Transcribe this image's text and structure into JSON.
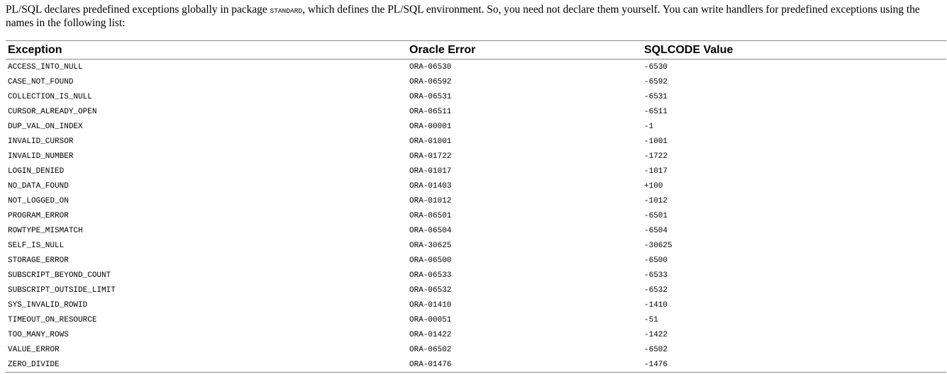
{
  "intro": {
    "text_before": "PL/SQL declares predefined exceptions globally in package ",
    "package_name": "STANDARD",
    "text_after": ", which defines the PL/SQL environment. So, you need not declare them yourself. You can write handlers for predefined exceptions using the names in the following list:"
  },
  "table": {
    "headers": {
      "exception": "Exception",
      "oracle_error": "Oracle Error",
      "sqlcode": "SQLCODE Value"
    },
    "rows": [
      {
        "exception": "ACCESS_INTO_NULL",
        "oracle_error": "ORA-06530",
        "sqlcode": "-6530"
      },
      {
        "exception": "CASE_NOT_FOUND",
        "oracle_error": "ORA-06592",
        "sqlcode": "-6592"
      },
      {
        "exception": "COLLECTION_IS_NULL",
        "oracle_error": "ORA-06531",
        "sqlcode": "-6531"
      },
      {
        "exception": "CURSOR_ALREADY_OPEN",
        "oracle_error": "ORA-06511",
        "sqlcode": "-6511"
      },
      {
        "exception": "DUP_VAL_ON_INDEX",
        "oracle_error": "ORA-00001",
        "sqlcode": "-1"
      },
      {
        "exception": "INVALID_CURSOR",
        "oracle_error": "ORA-01001",
        "sqlcode": "-1001"
      },
      {
        "exception": "INVALID_NUMBER",
        "oracle_error": "ORA-01722",
        "sqlcode": "-1722"
      },
      {
        "exception": "LOGIN_DENIED",
        "oracle_error": "ORA-01017",
        "sqlcode": "-1017"
      },
      {
        "exception": "NO_DATA_FOUND",
        "oracle_error": "ORA-01403",
        "sqlcode": "+100"
      },
      {
        "exception": "NOT_LOGGED_ON",
        "oracle_error": "ORA-01012",
        "sqlcode": "-1012"
      },
      {
        "exception": "PROGRAM_ERROR",
        "oracle_error": "ORA-06501",
        "sqlcode": "-6501"
      },
      {
        "exception": "ROWTYPE_MISMATCH",
        "oracle_error": "ORA-06504",
        "sqlcode": "-6504"
      },
      {
        "exception": "SELF_IS_NULL",
        "oracle_error": "ORA-30625",
        "sqlcode": "-30625"
      },
      {
        "exception": "STORAGE_ERROR",
        "oracle_error": "ORA-06500",
        "sqlcode": "-6500"
      },
      {
        "exception": "SUBSCRIPT_BEYOND_COUNT",
        "oracle_error": "ORA-06533",
        "sqlcode": "-6533"
      },
      {
        "exception": "SUBSCRIPT_OUTSIDE_LIMIT",
        "oracle_error": "ORA-06532",
        "sqlcode": "-6532"
      },
      {
        "exception": "SYS_INVALID_ROWID",
        "oracle_error": "ORA-01410",
        "sqlcode": "-1410"
      },
      {
        "exception": "TIMEOUT_ON_RESOURCE",
        "oracle_error": "ORA-00051",
        "sqlcode": "-51"
      },
      {
        "exception": "TOO_MANY_ROWS",
        "oracle_error": "ORA-01422",
        "sqlcode": "-1422"
      },
      {
        "exception": "VALUE_ERROR",
        "oracle_error": "ORA-06502",
        "sqlcode": "-6502"
      },
      {
        "exception": "ZERO_DIVIDE",
        "oracle_error": "ORA-01476",
        "sqlcode": "-1476"
      }
    ]
  }
}
